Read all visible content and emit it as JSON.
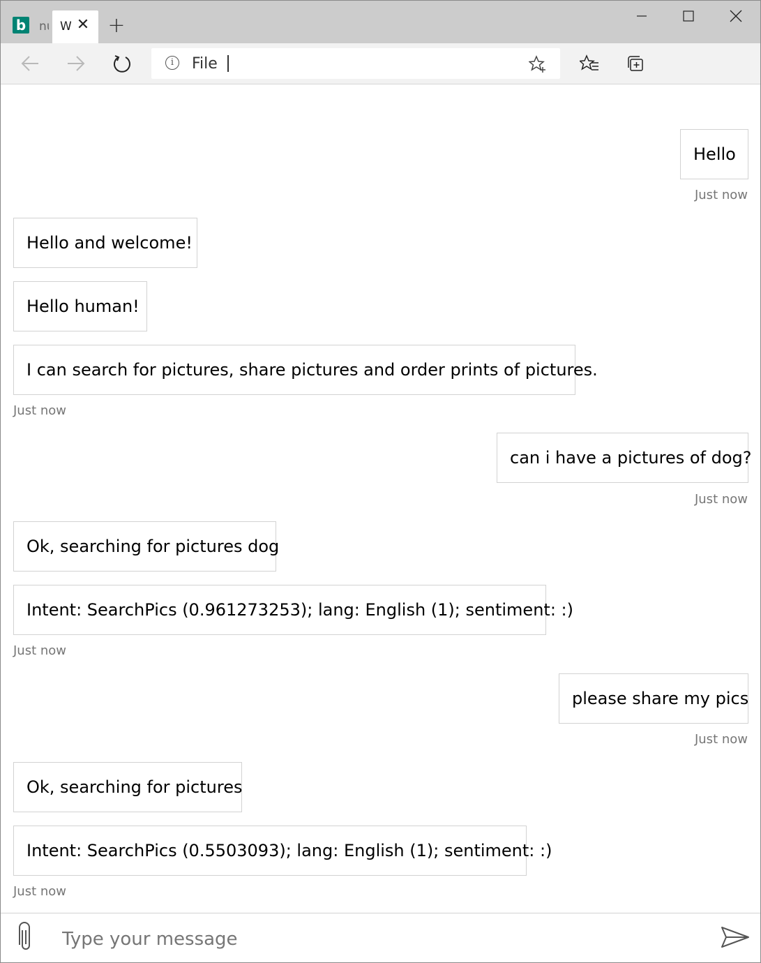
{
  "browser": {
    "tabs": [
      {
        "title": "nu",
        "active": false
      },
      {
        "title": "W",
        "active": true
      }
    ],
    "new_tab_label": "+",
    "address": {
      "scheme_label": "File"
    }
  },
  "chat": {
    "messages": [
      {
        "from": "user",
        "text": "Hello",
        "timestamp": "Just now"
      },
      {
        "from": "bot",
        "text": "Hello and welcome!"
      },
      {
        "from": "bot",
        "text": "Hello human!"
      },
      {
        "from": "bot",
        "text": "I can search for pictures, share pictures and order prints of pictures.",
        "timestamp": "Just now"
      },
      {
        "from": "user",
        "text": "can i have a pictures of dog?",
        "timestamp": "Just now"
      },
      {
        "from": "bot",
        "text": "Ok, searching for pictures dog"
      },
      {
        "from": "bot",
        "text": "Intent: SearchPics (0.961273253); lang: English (1); sentiment: :)",
        "timestamp": "Just now"
      },
      {
        "from": "user",
        "text": "please share my pics",
        "timestamp": "Just now"
      },
      {
        "from": "bot",
        "text": "Ok, searching for pictures"
      },
      {
        "from": "bot",
        "text": "Intent: SearchPics (0.5503093); lang: English (1); sentiment: :)",
        "timestamp": "Just now"
      }
    ]
  },
  "composer": {
    "placeholder": "Type your message"
  },
  "colors": {
    "titlebar": "#cccccc",
    "toolbar": "#f2f2f2",
    "bing": "#008373",
    "bubble_border": "#d2d2d2",
    "timestamp": "#767676"
  }
}
